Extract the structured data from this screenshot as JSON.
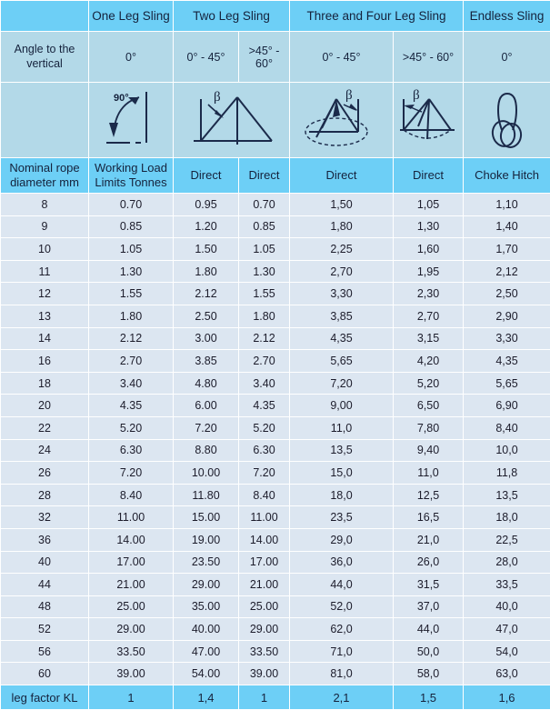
{
  "table": {
    "group_headers": [
      {
        "label": "",
        "span": 1
      },
      {
        "label": "One Leg Sling",
        "span": 1
      },
      {
        "label": "Two Leg Sling",
        "span": 2
      },
      {
        "label": "Three and Four Leg Sling",
        "span": 2
      },
      {
        "label": "Endless Sling",
        "span": 1
      }
    ],
    "angle_row": {
      "label": "Angle to the vertical",
      "values": [
        "0°",
        "0° - 45°",
        ">45° - 60°",
        "0° - 45°",
        ">45° - 60°",
        "0°"
      ]
    },
    "diagram_row": {
      "diagrams": [
        {
          "name": "one-leg-sling-diagram",
          "label": "90°"
        },
        {
          "name": "two-leg-sling-diagram",
          "label": "β"
        },
        {
          "name": "three-leg-sling-diagram",
          "label": "β"
        },
        {
          "name": "four-leg-sling-diagram",
          "label": "β"
        },
        {
          "name": "endless-sling-diagram",
          "label": ""
        }
      ]
    },
    "sub_headers": [
      "Nominal rope diameter mm",
      "Working Load Limits Tonnes",
      "Direct",
      "Direct",
      "Direct",
      "Direct",
      "Choke Hitch"
    ],
    "rows": [
      [
        "8",
        "0.70",
        "0.95",
        "0.70",
        "1,50",
        "1,05",
        "1,10"
      ],
      [
        "9",
        "0.85",
        "1.20",
        "0.85",
        "1,80",
        "1,30",
        "1,40"
      ],
      [
        "10",
        "1.05",
        "1.50",
        "1.05",
        "2,25",
        "1,60",
        "1,70"
      ],
      [
        "11",
        "1.30",
        "1.80",
        "1.30",
        "2,70",
        "1,95",
        "2,12"
      ],
      [
        "12",
        "1.55",
        "2.12",
        "1.55",
        "3,30",
        "2,30",
        "2,50"
      ],
      [
        "13",
        "1.80",
        "2.50",
        "1.80",
        "3,85",
        "2,70",
        "2,90"
      ],
      [
        "14",
        "2.12",
        "3.00",
        "2.12",
        "4,35",
        "3,15",
        "3,30"
      ],
      [
        "16",
        "2.70",
        "3.85",
        "2.70",
        "5,65",
        "4,20",
        "4,35"
      ],
      [
        "18",
        "3.40",
        "4.80",
        "3.40",
        "7,20",
        "5,20",
        "5,65"
      ],
      [
        "20",
        "4.35",
        "6.00",
        "4.35",
        "9,00",
        "6,50",
        "6,90"
      ],
      [
        "22",
        "5.20",
        "7.20",
        "5.20",
        "11,0",
        "7,80",
        "8,40"
      ],
      [
        "24",
        "6.30",
        "8.80",
        "6.30",
        "13,5",
        "9,40",
        "10,0"
      ],
      [
        "26",
        "7.20",
        "10.00",
        "7.20",
        "15,0",
        "11,0",
        "11,8"
      ],
      [
        "28",
        "8.40",
        "11.80",
        "8.40",
        "18,0",
        "12,5",
        "13,5"
      ],
      [
        "32",
        "11.00",
        "15.00",
        "11.00",
        "23,5",
        "16,5",
        "18,0"
      ],
      [
        "36",
        "14.00",
        "19.00",
        "14.00",
        "29,0",
        "21,0",
        "22,5"
      ],
      [
        "40",
        "17.00",
        "23.50",
        "17.00",
        "36,0",
        "26,0",
        "28,0"
      ],
      [
        "44",
        "21.00",
        "29.00",
        "21.00",
        "44,0",
        "31,5",
        "33,5"
      ],
      [
        "48",
        "25.00",
        "35.00",
        "25.00",
        "52,0",
        "37,0",
        "40,0"
      ],
      [
        "52",
        "29.00",
        "40.00",
        "29.00",
        "62,0",
        "44,0",
        "47,0"
      ],
      [
        "56",
        "33.50",
        "47.00",
        "33.50",
        "71,0",
        "50,0",
        "54,0"
      ],
      [
        "60",
        "39.00",
        "54.00",
        "39.00",
        "81,0",
        "58,0",
        "63,0"
      ]
    ],
    "footer": [
      "leg factor KL",
      "1",
      "1,4",
      "1",
      "2,1",
      "1,5",
      "1,6"
    ]
  },
  "colors": {
    "header_blue": "#6DCFF6",
    "diagram_blue": "#B3D9E8",
    "data_blue": "#DCE6F1",
    "grid_white": "#FFFFFF",
    "ink": "#15223C"
  }
}
